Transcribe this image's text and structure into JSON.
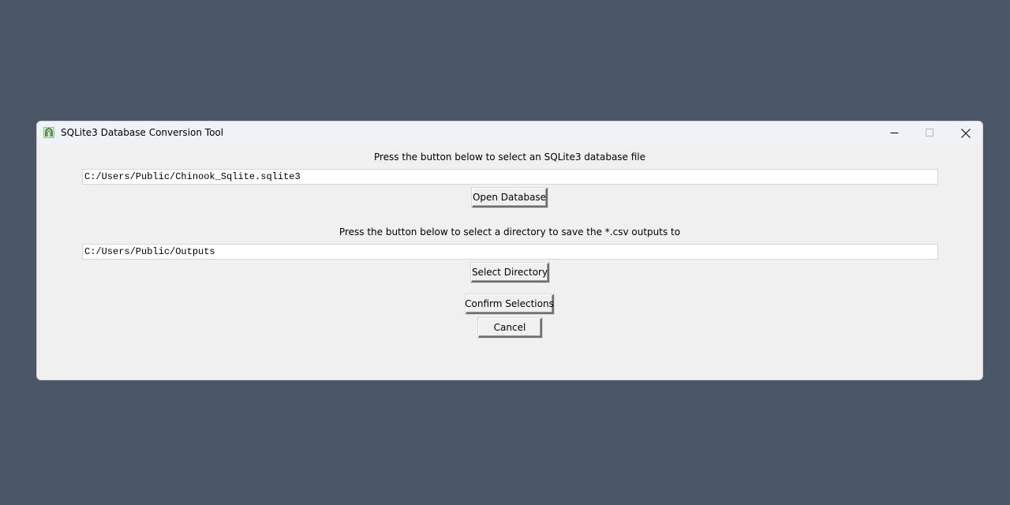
{
  "window": {
    "title": "SQLite3 Database Conversion Tool"
  },
  "database": {
    "prompt": "Press the button below to select an SQLite3 database file",
    "path": "C:/Users/Public/Chinook_Sqlite.sqlite3",
    "button_label": "Open Database"
  },
  "output": {
    "prompt": "Press the button below to select a directory to save the *.csv outputs to",
    "path": "C:/Users/Public/Outputs",
    "button_label": "Select Directory"
  },
  "actions": {
    "confirm_label": "Confirm Selections",
    "cancel_label": "Cancel"
  },
  "icons": {
    "app": "app-feather-icon",
    "minimize": "minimize-icon",
    "maximize": "maximize-icon",
    "close": "close-icon"
  }
}
